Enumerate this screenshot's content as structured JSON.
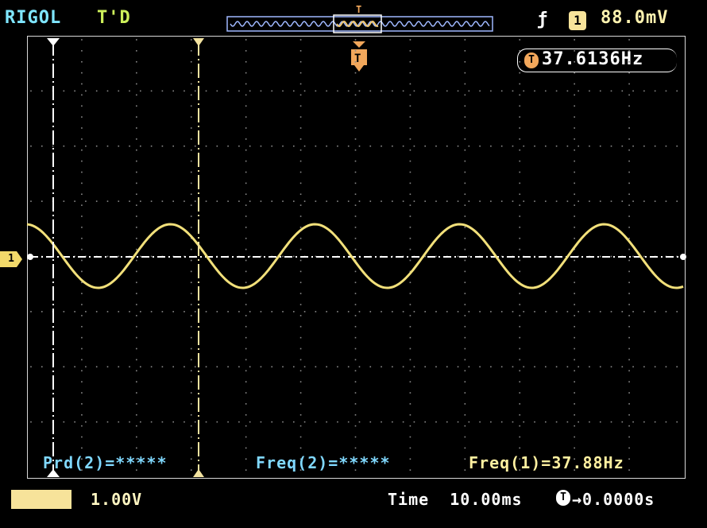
{
  "header": {
    "brand": "RIGOL",
    "trigger_state": "T'D",
    "trigger_edge_icon": "rising-edge-icon",
    "trigger_channel": "1",
    "trigger_level": "88.0mV",
    "trigger_badge": "T",
    "trigger_freq": "37.6136Hz",
    "memory_trigger_marker": "T"
  },
  "channel_marker": "1",
  "measurements": {
    "period2": "Prd(2)=*****",
    "freq2": "Freq(2)=*****",
    "freq1": "Freq(1)=37.88Hz"
  },
  "footer": {
    "vertical_scale": "1.00V",
    "time_label": "Time",
    "timebase": "10.00ms",
    "trigger_offset_badge": "T",
    "trigger_offset": "→0.0000s"
  },
  "colors": {
    "waveform": "#f2e07a",
    "grid_dots": "#9a9a9a",
    "cursor_a": "#ffffff",
    "cursor_b": "#f3e3a0",
    "ref_line": "#ffffff",
    "measure_cyan": "#80d8ff",
    "trigger_orange": "#f2a75b"
  }
}
